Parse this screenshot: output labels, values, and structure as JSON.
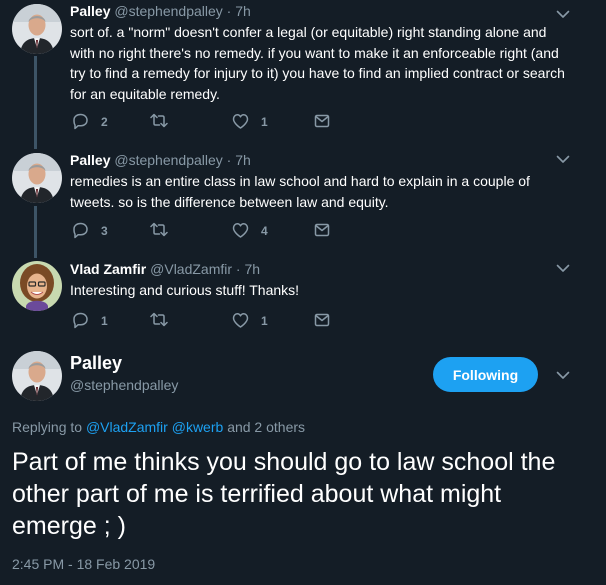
{
  "tweets": [
    {
      "name": "Palley",
      "meta": "@stephendpalley · 7h",
      "text": "sort of. a \"norm\" doesn't confer a legal (or equitable) right standing alone and with no right there's no remedy. if you want to make it an enforceable right (and try to find a remedy for injury to it) you have to find an implied contract or search for an equitable remedy.",
      "replies": "2",
      "retweets": "",
      "likes": "1"
    },
    {
      "name": "Palley",
      "meta": "@stephendpalley · 7h",
      "text": "remedies is an entire class in law school and hard to explain in a couple of tweets.  so is the difference between law and equity.",
      "replies": "3",
      "retweets": "",
      "likes": "4"
    },
    {
      "name": "Vlad Zamfir",
      "meta": "@VladZamfir · 7h",
      "text": "Interesting and curious stuff! Thanks!",
      "replies": "1",
      "retweets": "",
      "likes": "1"
    }
  ],
  "main": {
    "name": "Palley",
    "handle": "@stephendpalley",
    "follow_label": "Following",
    "replying_prefix": "Replying to",
    "mention1": "@VladZamfir",
    "mention2": "@kwerb",
    "replying_suffix": "and 2 others",
    "text": "Part of me thinks you should go to law school the other part of me is terrified about what might emerge ; )",
    "timestamp": "2:45 PM - 18 Feb 2019"
  },
  "icons": {
    "reply": "reply-icon",
    "retweet": "retweet-icon",
    "like": "heart-icon",
    "dm": "envelope-icon",
    "more": "chevron-down-icon"
  },
  "colors": {
    "background": "#141d26",
    "accent": "#1da1f2",
    "muted": "#8899a6",
    "thread_line": "#3d5466"
  }
}
